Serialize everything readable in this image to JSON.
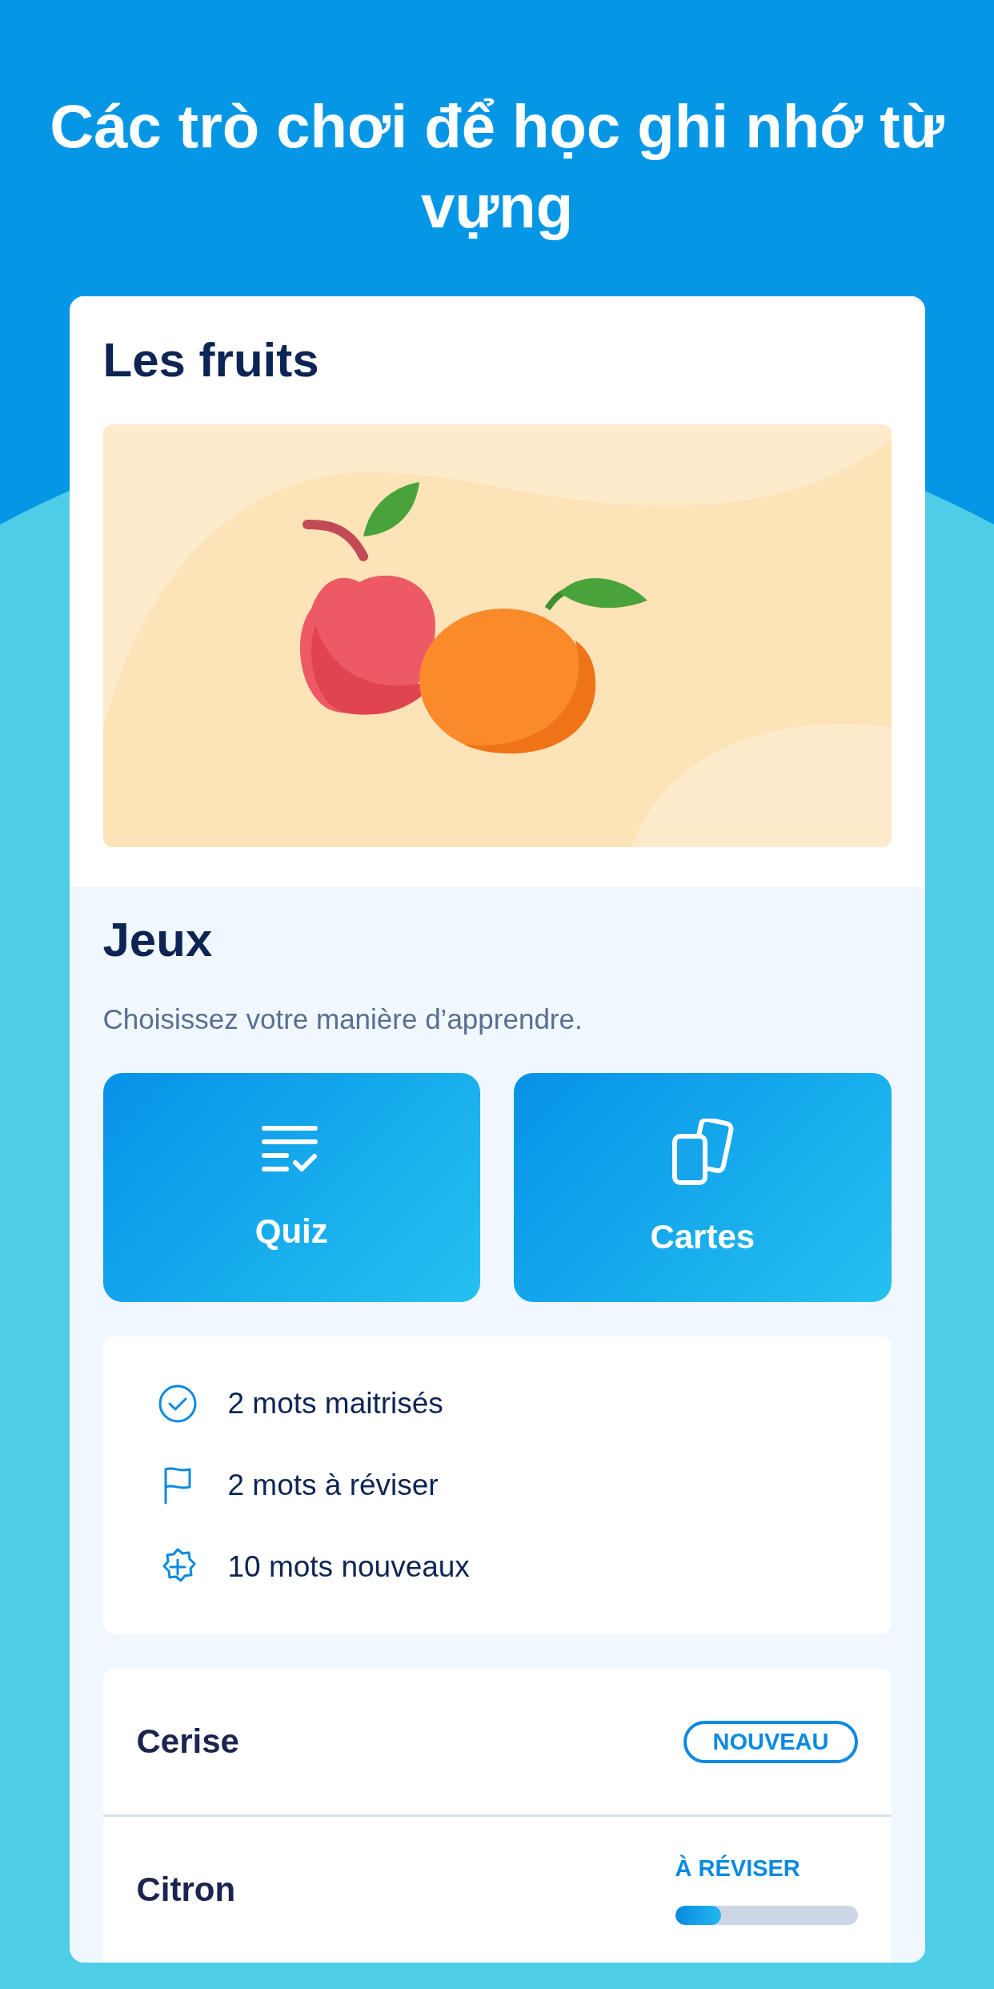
{
  "title": "Các trò chơi để học ghi nhớ từ vựng",
  "topic": {
    "title": "Les fruits"
  },
  "games": {
    "title": "Jeux",
    "subtitle": "Choisissez votre manière d’apprendre.",
    "buttons": [
      {
        "label": "Quiz"
      },
      {
        "label": "Cartes"
      }
    ]
  },
  "stats": [
    {
      "text": "2 mots maitrisés"
    },
    {
      "text": "2 mots à réviser"
    },
    {
      "text": "10 mots nouveaux"
    }
  ],
  "words": [
    {
      "word": "Cerise",
      "kind": "new",
      "status": "NOUVEAU"
    },
    {
      "word": "Citron",
      "kind": "review",
      "status": "À RÉVISER",
      "level": 0.25
    }
  ]
}
